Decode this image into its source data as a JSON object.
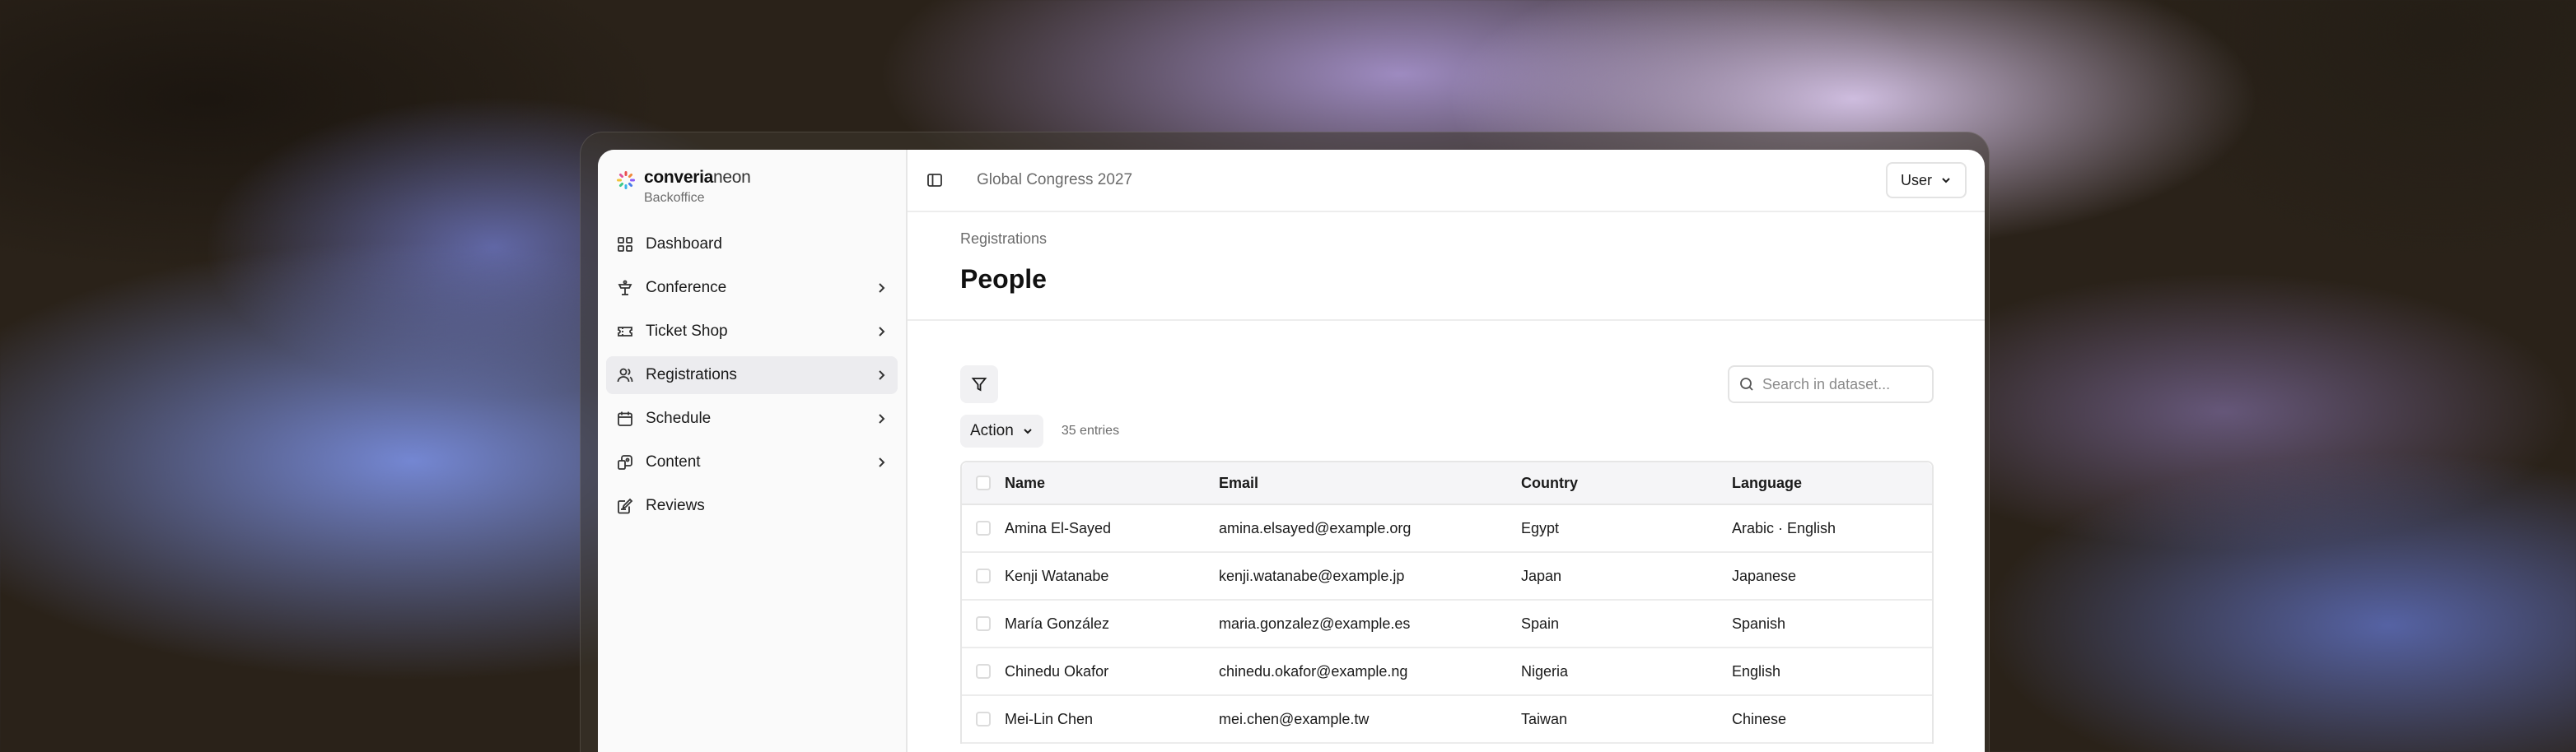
{
  "brand": {
    "name_bold": "converia",
    "name_light": "neon",
    "subtitle": "Backoffice"
  },
  "sidebar": {
    "items": [
      {
        "label": "Dashboard",
        "icon": "grid-icon"
      },
      {
        "label": "Conference",
        "icon": "podium-icon"
      },
      {
        "label": "Ticket Shop",
        "icon": "ticket-icon"
      },
      {
        "label": "Registrations",
        "icon": "users-icon"
      },
      {
        "label": "Schedule",
        "icon": "calendar-icon"
      },
      {
        "label": "Content",
        "icon": "content-icon"
      },
      {
        "label": "Reviews",
        "icon": "review-icon"
      }
    ]
  },
  "topbar": {
    "project": "Global Congress 2027",
    "user_label": "User"
  },
  "page": {
    "breadcrumb": "Registrations",
    "title": "People"
  },
  "toolbar": {
    "search_placeholder": "Search in dataset...",
    "action_label": "Action",
    "entries": "35 entries"
  },
  "table": {
    "columns": [
      "Name",
      "Email",
      "Country",
      "Language"
    ],
    "rows": [
      {
        "name": "Amina El-Sayed",
        "email": "amina.elsayed@example.org",
        "country": "Egypt",
        "language": "Arabic · English"
      },
      {
        "name": "Kenji Watanabe",
        "email": "kenji.watanabe@example.jp",
        "country": "Japan",
        "language": "Japanese"
      },
      {
        "name": "María González",
        "email": "maria.gonzalez@example.es",
        "country": "Spain",
        "language": "Spanish"
      },
      {
        "name": "Chinedu Okafor",
        "email": "chinedu.okafor@example.ng",
        "country": "Nigeria",
        "language": "English"
      },
      {
        "name": "Mei-Lin Chen",
        "email": "mei.chen@example.tw",
        "country": "Taiwan",
        "language": "Chinese"
      }
    ]
  }
}
